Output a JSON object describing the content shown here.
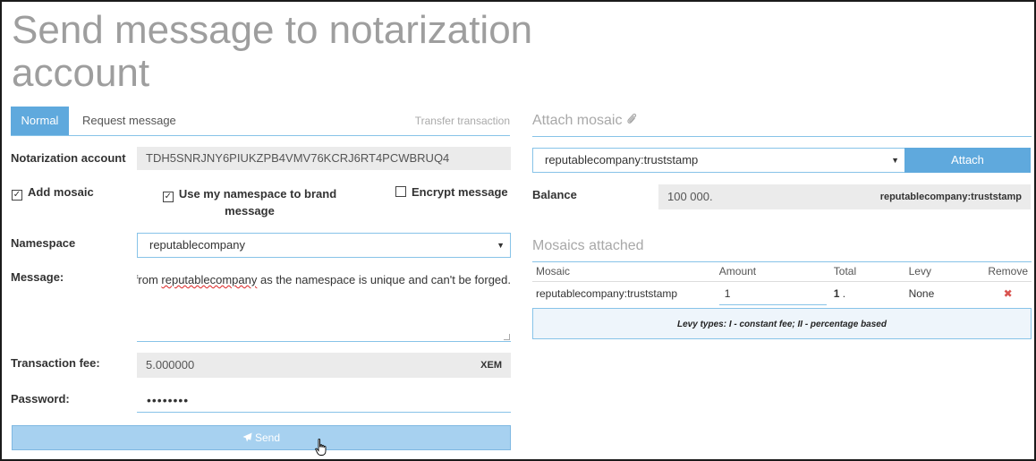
{
  "page": {
    "title": "Send message to notarization account"
  },
  "tabs": {
    "normal": "Normal",
    "request": "Request message",
    "type": "Transfer transaction"
  },
  "form": {
    "account_label": "Notarization account",
    "account_value": "TDH5SNRJNY6PIUKZPB4VMV76KCRJ6RT4PCWBRUQ4",
    "add_mosaic_label": "Add mosaic",
    "add_mosaic_checked": true,
    "use_namespace_label": "Use my namespace to brand message",
    "use_namespace_checked": true,
    "encrypt_label": "Encrypt message",
    "encrypt_checked": false,
    "namespace_label": "Namespace",
    "namespace_value": "reputablecompany",
    "message_label": "Message:",
    "message_pre": "ne from ",
    "message_word": "reputablecompany",
    "message_post": " as the namespace is unique and can't be forged.",
    "fee_label": "Transaction fee:",
    "fee_value": "5.000000",
    "fee_unit": "XEM",
    "password_label": "Password:",
    "password_value": "••••••••",
    "send_label": "Send"
  },
  "mosaic": {
    "section_title": "Attach mosaic",
    "select_value": "reputablecompany:truststamp",
    "attach_label": "Attach",
    "balance_label": "Balance",
    "balance_value": "100 000.",
    "balance_unit": "reputablecompany:truststamp"
  },
  "attached": {
    "section_title": "Mosaics attached",
    "headers": {
      "mosaic": "Mosaic",
      "amount": "Amount",
      "total": "Total",
      "levy": "Levy",
      "remove": "Remove"
    },
    "rows": [
      {
        "ns": "reputablecompany",
        "sep": ":",
        "name": "truststamp",
        "amount": "1",
        "total": "1",
        "total_suffix": " .",
        "levy": "None"
      }
    ],
    "levy_note": "Levy types: I - constant fee; II - percentage based"
  },
  "icons": {
    "paperclip": "paperclip-icon",
    "send": "paper-plane-icon",
    "remove": "close-icon",
    "check": "check-icon"
  },
  "colors": {
    "accent": "#5fa9dd",
    "send_button": "#a7d1f0",
    "remove": "#d9534f"
  }
}
